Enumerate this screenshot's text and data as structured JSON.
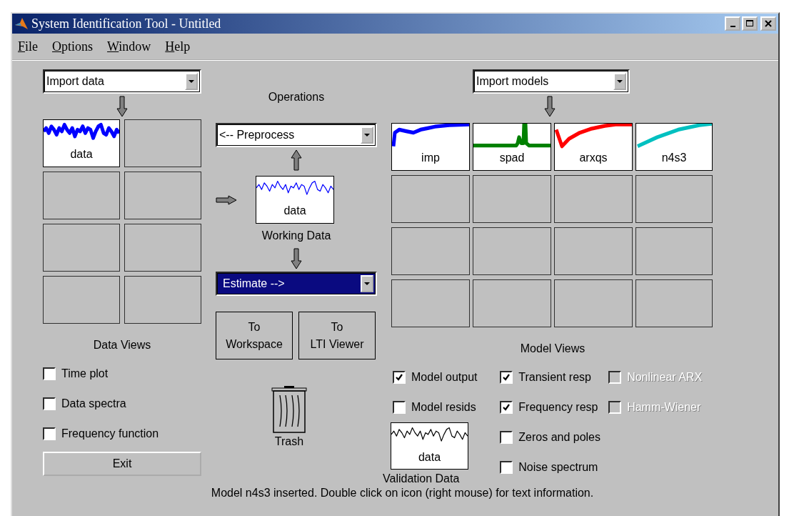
{
  "window": {
    "title": "System Identification Tool - Untitled"
  },
  "menu": [
    {
      "label": "File"
    },
    {
      "label": "Options"
    },
    {
      "label": "Window"
    },
    {
      "label": "Help"
    }
  ],
  "data_panel": {
    "dropdown": "Import data",
    "tiles": [
      {
        "kind": "noise",
        "label": "data",
        "color": "#0000ff"
      },
      {
        "kind": "empty"
      },
      {
        "kind": "empty"
      },
      {
        "kind": "empty"
      },
      {
        "kind": "empty"
      },
      {
        "kind": "empty"
      },
      {
        "kind": "empty"
      },
      {
        "kind": "empty"
      }
    ],
    "title": "Data Views",
    "checks": [
      {
        "label": "Time plot",
        "checked": false,
        "disabled": false
      },
      {
        "label": "Data spectra",
        "checked": false,
        "disabled": false
      },
      {
        "label": "Frequency function",
        "checked": false,
        "disabled": false
      }
    ],
    "exit": "Exit"
  },
  "operations": {
    "title": "Operations",
    "preprocess": "<-- Preprocess",
    "working_tile": {
      "kind": "noise",
      "label": "data",
      "color": "#0000ff"
    },
    "working_label": "Working Data",
    "estimate": "Estimate -->",
    "buttons": [
      "To\nWorkspace",
      "To\nLTI Viewer"
    ],
    "trash_label": "Trash"
  },
  "model_panel": {
    "dropdown": "Import models",
    "tiles": [
      {
        "kind": "step",
        "label": "imp",
        "color": "#0000ff"
      },
      {
        "kind": "spike",
        "label": "spad",
        "color": "#008000"
      },
      {
        "kind": "dip",
        "label": "arxqs",
        "color": "#ff0000"
      },
      {
        "kind": "ramp",
        "label": "n4s3",
        "color": "#00c0c0"
      },
      {
        "kind": "empty"
      },
      {
        "kind": "empty"
      },
      {
        "kind": "empty"
      },
      {
        "kind": "empty"
      },
      {
        "kind": "empty"
      },
      {
        "kind": "empty"
      },
      {
        "kind": "empty"
      },
      {
        "kind": "empty"
      },
      {
        "kind": "empty"
      },
      {
        "kind": "empty"
      },
      {
        "kind": "empty"
      },
      {
        "kind": "empty"
      }
    ],
    "title": "Model Views",
    "check_columns": [
      [
        {
          "label": "Model output",
          "checked": true,
          "disabled": false
        },
        {
          "label": "Model resids",
          "checked": false,
          "disabled": false
        }
      ],
      [
        {
          "label": "Transient resp",
          "checked": true,
          "disabled": false
        },
        {
          "label": "Frequency resp",
          "checked": true,
          "disabled": false
        },
        {
          "label": "Zeros and poles",
          "checked": false,
          "disabled": false
        },
        {
          "label": "Noise spectrum",
          "checked": false,
          "disabled": false
        }
      ],
      [
        {
          "label": "Nonlinear ARX",
          "checked": false,
          "disabled": true
        },
        {
          "label": "Hamm-Wiener",
          "checked": false,
          "disabled": true
        }
      ]
    ],
    "validation_tile": {
      "kind": "noise",
      "label": "data",
      "color": "#000000"
    },
    "validation_label": "Validation Data"
  },
  "status": "Model n4s3 inserted.  Double click on icon (right mouse) for text information."
}
